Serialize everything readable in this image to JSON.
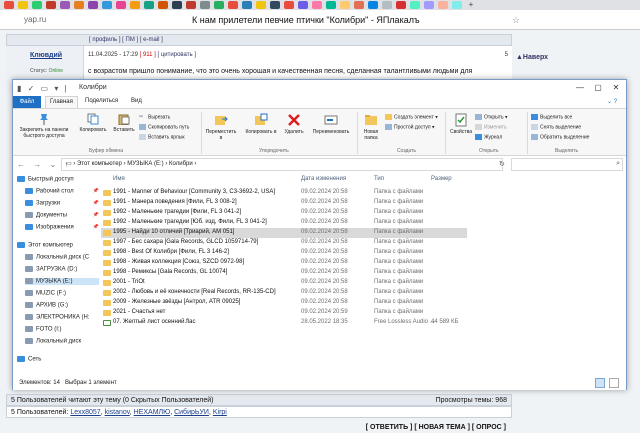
{
  "browser": {
    "tab_colors": [
      "#e74c3c",
      "#f1c40f",
      "#2ecc71",
      "#c0392b",
      "#9b59b6",
      "#e67e22",
      "#8e44ad",
      "#3498db",
      "#e84393",
      "#f39c12",
      "#16a085",
      "#d35400",
      "#2c3e50",
      "#c0392b",
      "#7f8c8d",
      "#27ae60",
      "#e74c3c",
      "#2980b9",
      "#f1c40f",
      "#34495e",
      "#e74c3c",
      "#6c5ce7",
      "#fd79a8",
      "#00b894",
      "#fdcb6e",
      "#e17055",
      "#0984e3",
      "#b2bec3",
      "#d63031",
      "#55efc4",
      "#a29bfe",
      "#fab1a0",
      "#81ecec"
    ],
    "url": "yap.ru",
    "page_title": "К нам прилетели певчие птички \"Колибри\" - ЯПлакалъ"
  },
  "forum": {
    "post_links": "[ профиль ]  [ ПМ ]  [ e-mail ]",
    "author": "Клювдий",
    "status_label": "Статус:",
    "status_value": "Online",
    "post_date": "11.04.2025 - 17:29",
    "post_number": "[ 911 ]",
    "quote_link": "[ цитировать ]",
    "rank": "5",
    "body": "с возрастом пришло понимание, что это очень хорошая и качественная песня, сделанная талантливыми людьми для",
    "up_link": "▲Наверх",
    "readers": "5 Пользователей читают эту тему (0 Скрытых Пользователей)",
    "views": "Просмотры темы: 968",
    "users_label": "5 Пользователей:",
    "users": [
      "Lexx8057",
      "kistanov",
      "НЕХАМЛЮ",
      "СибирЬУИ",
      "Kirpi"
    ],
    "bottom_links": "[ ОТВЕТИТЬ ]  [ НОВАЯ ТЕМА ]  [ ОПРОС ]"
  },
  "explorer": {
    "title": "Колибри",
    "tabs": {
      "file": "Файл",
      "home": "Главная",
      "share": "Поделиться",
      "view": "Вид"
    },
    "ribbon": {
      "pin": "Закрепить на панели быстрого доступа",
      "copy": "Копировать",
      "paste": "Вставить",
      "cut": "Вырезать",
      "copy_path": "Скопировать путь",
      "paste_shortcut": "Вставить ярлык",
      "group_clipboard": "Буфер обмена",
      "move_to": "Переместить в",
      "copy_to": "Копировать в",
      "delete": "Удалить",
      "rename": "Переименовать",
      "group_organize": "Упорядочить",
      "new_folder": "Новая папка",
      "new_item": "Создать элемент ▾",
      "easy_access": "Простой доступ ▾",
      "group_create": "Создать",
      "properties": "Свойства",
      "open": "Открыть ▾",
      "edit": "Изменить",
      "history": "Журнал",
      "group_open": "Открыть",
      "select_all": "Выделить все",
      "select_none": "Снять выделение",
      "invert": "Обратить выделение",
      "group_select": "Выделить"
    },
    "path": [
      "Этот компьютер",
      "МУЗЫКА (E:)",
      "Колибри"
    ],
    "nav": [
      {
        "label": "Быстрый доступ",
        "icon": "star-icon",
        "color": "#3b8ede",
        "pin": false,
        "sel": false
      },
      {
        "label": "Рабочий стол",
        "icon": "desktop-icon",
        "color": "#3b8ede",
        "pin": true,
        "sel": false
      },
      {
        "label": "Загрузки",
        "icon": "downloads-icon",
        "color": "#3b8ede",
        "pin": true,
        "sel": false
      },
      {
        "label": "Документы",
        "icon": "documents-icon",
        "color": "#8a9bb1",
        "pin": true,
        "sel": false
      },
      {
        "label": "Изображения",
        "icon": "pictures-icon",
        "color": "#3b8ede",
        "pin": true,
        "sel": false
      },
      {
        "label": "Этот компьютер",
        "icon": "computer-icon",
        "color": "#3b8ede",
        "pin": false,
        "sel": false
      },
      {
        "label": "Локальный диск (C",
        "icon": "drive-icon",
        "color": "#8a9bb1",
        "pin": false,
        "sel": false
      },
      {
        "label": "ЗАГРУЗКА (D:)",
        "icon": "drive-icon",
        "color": "#8a9bb1",
        "pin": false,
        "sel": false
      },
      {
        "label": "МУЗЫКА (E:)",
        "icon": "drive-icon",
        "color": "#8a9bb1",
        "pin": false,
        "sel": true
      },
      {
        "label": "MUZIC (F:)",
        "icon": "drive-icon",
        "color": "#8a9bb1",
        "pin": false,
        "sel": false
      },
      {
        "label": "АРХИВ (G:)",
        "icon": "drive-icon",
        "color": "#8a9bb1",
        "pin": false,
        "sel": false
      },
      {
        "label": "ЭЛЕКТРОНИКА (H:",
        "icon": "drive-icon",
        "color": "#8a9bb1",
        "pin": false,
        "sel": false
      },
      {
        "label": "FOTO (I:)",
        "icon": "drive-icon",
        "color": "#8a9bb1",
        "pin": false,
        "sel": false
      },
      {
        "label": "Локальный диск",
        "icon": "drive-icon",
        "color": "#8a9bb1",
        "pin": false,
        "sel": false
      },
      {
        "label": "Сеть",
        "icon": "network-icon",
        "color": "#3b8ede",
        "pin": false,
        "sel": false
      }
    ],
    "columns": {
      "name": "Имя",
      "date": "Дата изменения",
      "type": "Тип",
      "size": "Размер"
    },
    "files": [
      {
        "name": "1991 - Manner of Behaviour [Community 3, C3-3692-2, USA]",
        "date": "09.02.2024 20:58",
        "type": "Папка с файлами",
        "size": "",
        "flac": false,
        "sel": false
      },
      {
        "name": "1991 - Манера поведения [Фили, FL 3 008-2]",
        "date": "09.02.2024 20:58",
        "type": "Папка с файлами",
        "size": "",
        "flac": false,
        "sel": false
      },
      {
        "name": "1992 - Маленькие трагедии [Фили, FL 3 041-2]",
        "date": "09.02.2024 20:58",
        "type": "Папка с файлами",
        "size": "",
        "flac": false,
        "sel": false
      },
      {
        "name": "1992 - Маленькие трагедии [Юб. изд, Фили, FL 3 041-2]",
        "date": "09.02.2024 20:58",
        "type": "Папка с файлами",
        "size": "",
        "flac": false,
        "sel": false
      },
      {
        "name": "1995 - Найди 10 отличий [Триарий, AM 051]",
        "date": "09.02.2024 20:58",
        "type": "Папка с файлами",
        "size": "",
        "flac": false,
        "sel": true
      },
      {
        "name": "1997 - Бес сахара [Gala Records, GLCD 1059714-79]",
        "date": "09.02.2024 20:58",
        "type": "Папка с файлами",
        "size": "",
        "flac": false,
        "sel": false
      },
      {
        "name": "1998 - Best Of Колибри [Фили, FL 3 146-2]",
        "date": "09.02.2024 20:58",
        "type": "Папка с файлами",
        "size": "",
        "flac": false,
        "sel": false
      },
      {
        "name": "1998 - Живая коллекция [Союз, SZCD 0972-98]",
        "date": "09.02.2024 20:58",
        "type": "Папка с файлами",
        "size": "",
        "flac": false,
        "sel": false
      },
      {
        "name": "1998 - Ремиксы [Gala Records, GL 10074]",
        "date": "09.02.2024 20:58",
        "type": "Папка с файлами",
        "size": "",
        "flac": false,
        "sel": false
      },
      {
        "name": "2001 - TriOt",
        "date": "09.02.2024 20:58",
        "type": "Папка с файлами",
        "size": "",
        "flac": false,
        "sel": false
      },
      {
        "name": "2002 - Любовь и её конечности [Real Records, RR-135-CD]",
        "date": "09.02.2024 20:58",
        "type": "Папка с файлами",
        "size": "",
        "flac": false,
        "sel": false
      },
      {
        "name": "2009 - Железные звёзды [Антрол, ATR 09025]",
        "date": "09.02.2024 20:58",
        "type": "Папка с файлами",
        "size": "",
        "flac": false,
        "sel": false
      },
      {
        "name": "2021 - Счастья нет",
        "date": "09.02.2024 20:59",
        "type": "Папка с файлами",
        "size": "",
        "flac": false,
        "sel": false
      },
      {
        "name": "07. Желтый лист осенний.flac",
        "date": "28.05.2022 18:35",
        "type": "Free Lossless Audio ...",
        "size": "44 589 КБ",
        "flac": true,
        "sel": false
      }
    ],
    "status_count": "Элементов: 14",
    "status_selected": "Выбран 1 элемент"
  }
}
